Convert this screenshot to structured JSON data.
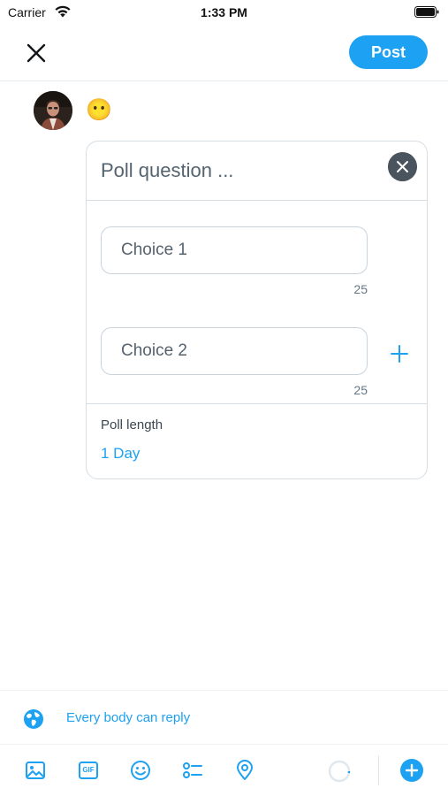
{
  "status_bar": {
    "carrier": "Carrier",
    "time": "1:33 PM",
    "battery_level": 1.0
  },
  "header": {
    "close_icon": "close-icon",
    "post_label": "Post",
    "accent_color": "#1da1f2"
  },
  "composer": {
    "avatar": "avatar",
    "emoji": "😶"
  },
  "poll": {
    "question_placeholder": "Poll question ...",
    "remove_icon": "close-icon",
    "choices": [
      {
        "placeholder": "Choice 1",
        "remaining": "25"
      },
      {
        "placeholder": "Choice 2",
        "remaining": "25"
      }
    ],
    "add_choice_icon": "plus-icon",
    "length_label": "Poll length",
    "length_value": "1 Day"
  },
  "reply_settings": {
    "icon": "globe-icon",
    "label": "Every body can reply"
  },
  "toolbar": {
    "icons": [
      "image-icon",
      "gif-icon",
      "emoji-icon",
      "poll-icon",
      "location-icon",
      "character-counter-icon",
      "add-tweet-icon"
    ],
    "gif_text": "GIF"
  }
}
